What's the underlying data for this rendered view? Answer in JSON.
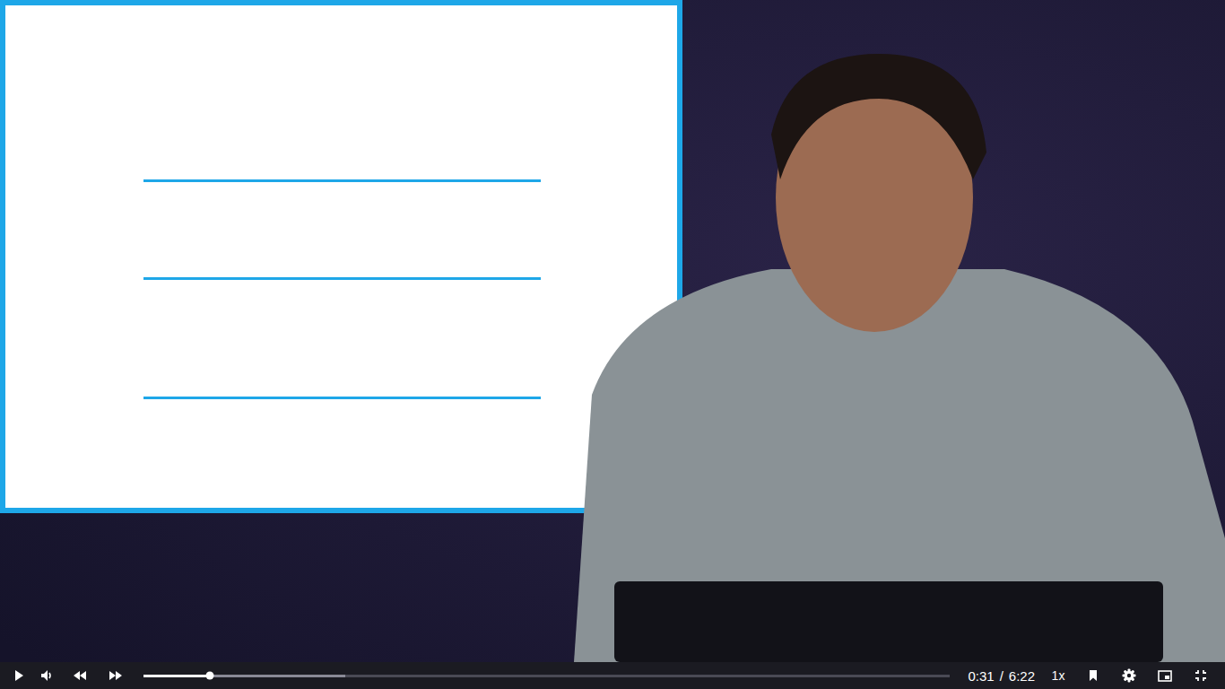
{
  "player": {
    "playing": false,
    "muted": false,
    "progress": {
      "level": 0.082,
      "buffered": 0.25
    },
    "current_time": "0:31",
    "separator": "/",
    "duration": "6:22",
    "speed": "1x"
  }
}
